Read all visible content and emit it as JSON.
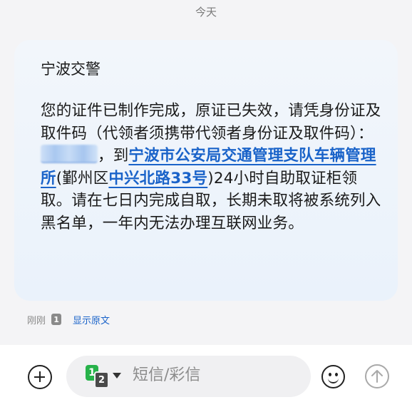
{
  "header": {
    "date_label": "今天"
  },
  "message": {
    "sender": "宁波交警",
    "text_parts": [
      "您的证件已制作完成，原证已失效，请凭身份证及取件码（代领者须携带代领者身份证及取件码）：",
      "，到",
      "(鄞州区",
      ")24小时自助取证柜领取。请在七日内完成自取，长期未取将被系统列入黑名单，一年内无法办理互联网业务。"
    ],
    "link_place": "宁波市公安局交通管理支队车辆管理所",
    "link_address": "中兴北路33号",
    "masked_code_note": "blurred pickup code"
  },
  "meta": {
    "time_label": "刚刚",
    "sim_badge": "1",
    "show_original_label": "显示原文"
  },
  "composer": {
    "sim_primary": "1",
    "sim_secondary": "2",
    "placeholder": "短信/彩信"
  },
  "colors": {
    "link": "#1a63c9",
    "sim_green": "#27b24a",
    "bubble_bg": "#eaf2fb"
  }
}
